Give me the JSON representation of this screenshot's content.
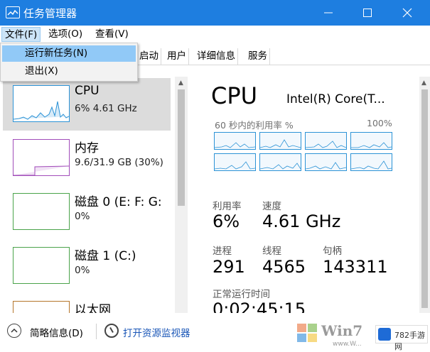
{
  "window": {
    "title": "任务管理器",
    "icon": "task-manager-icon"
  },
  "menubar": {
    "file": "文件(F)",
    "options": "选项(O)",
    "view": "查看(V)"
  },
  "file_menu": {
    "items": [
      "运行新任务(N)",
      "退出(X)"
    ]
  },
  "tabs": [
    "启动",
    "用户",
    "详细信息",
    "服务"
  ],
  "resources": [
    {
      "name": "CPU",
      "sub": "6% 4.61 GHz"
    },
    {
      "name": "内存",
      "sub": "9.6/31.9 GB (30%)"
    },
    {
      "name": "磁盘 0 (E: F: G:",
      "sub": "0%"
    },
    {
      "name": "磁盘 1 (C:)",
      "sub": "0%"
    },
    {
      "name": "以太网",
      "sub": ""
    }
  ],
  "detail": {
    "title": "CPU",
    "model": "Intel(R) Core(T...",
    "graph_caption": "60 秒内的利用率 %",
    "graph_max": "100%",
    "stats": {
      "utilization_label": "利用率",
      "utilization_value": "6%",
      "speed_label": "速度",
      "speed_value": "4.61 GHz",
      "processes_label": "进程",
      "processes_value": "291",
      "threads_label": "线程",
      "threads_value": "4565",
      "handles_label": "句柄",
      "handles_value": "143311",
      "uptime_label": "正常运行时间",
      "uptime_value": "0:02:45:15"
    }
  },
  "footer": {
    "fewer_details": "简略信息(D)",
    "open_resmon": "打开资源监视器"
  },
  "watermark": {
    "brand": "Win7",
    "site": "www.W...",
    "badge": "782手游网"
  },
  "colors": {
    "titlebar": "#1e7ee0",
    "cpu_accent": "#2c93d6",
    "memory_accent": "#a14cb9",
    "disk_accent": "#4aa34a",
    "ethernet_accent": "#b5762b",
    "menu_highlight": "#91c9f7",
    "link": "#1a56b7"
  }
}
